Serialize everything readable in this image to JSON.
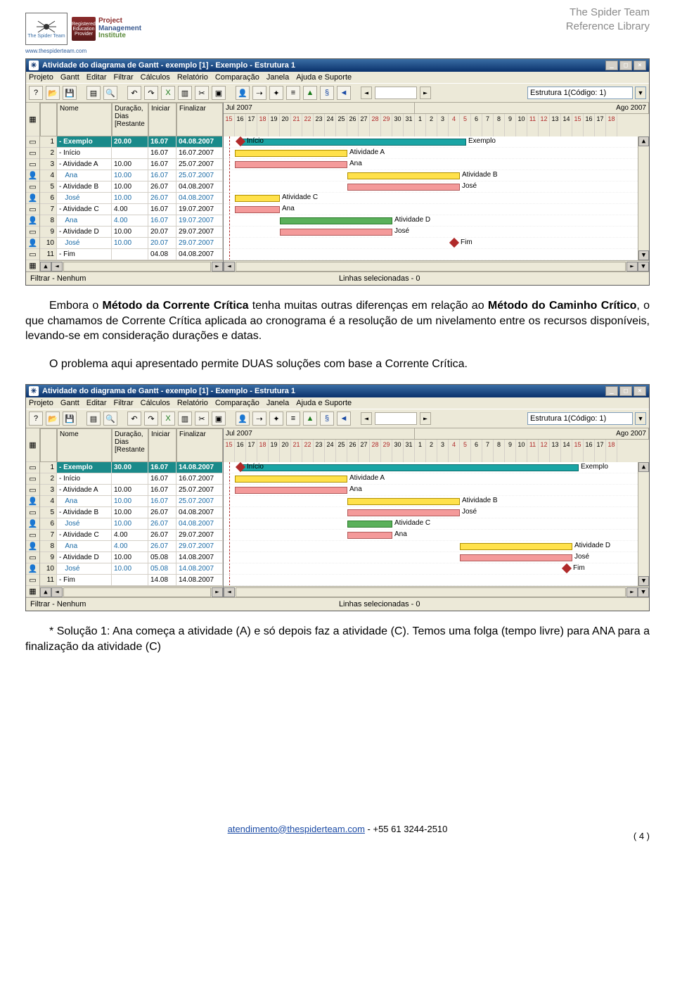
{
  "header": {
    "ref_line1": "The Spider Team",
    "ref_line2": "Reference Library",
    "spider_name": "The Spider Team",
    "url": "www.thespiderteam.com",
    "pmi1": "Project",
    "pmi2": "Management",
    "pmi3": "Institute",
    "pmi_badge": "Registered Education Provider"
  },
  "para1_a": "Embora o ",
  "para1_b": "Método da Corrente Crítica",
  "para1_c": " tenha muitas outras diferenças em relação ao ",
  "para1_d": "Método do Caminho Crítico",
  "para1_e": ", o que chamamos de Corrente Crítica aplicada ao cronograma é a resolução de um nivelamento entre os recursos disponíveis, levando-se em consideração durações e datas.",
  "para2": "O problema aqui apresentado permite DUAS soluções com base a Corrente Crítica.",
  "para3": "* Solução 1: Ana começa a atividade (A) e só depois faz a atividade (C). Temos uma folga (tempo livre) para ANA para a finalização da atividade (C)",
  "gantt_common": {
    "title": "Atividade do diagrama de Gantt - exemplo [1] - Exemplo - Estrutura 1",
    "menu": [
      "Projeto",
      "Gantt",
      "Editar",
      "Filtrar",
      "Cálculos",
      "Relatório",
      "Comparação",
      "Janela",
      "Ajuda e Suporte"
    ],
    "combo_value": "Estrutura 1(Código: 1)",
    "col_nome": "Nome",
    "col_dur": "Duração, Dias [Restante",
    "col_ini": "Iniciar",
    "col_fin": "Finalizar",
    "month1": "Jul 2007",
    "month2": "Ago 2007",
    "status_left": "Filtrar -  Nenhum",
    "status_mid": "Linhas selecionadas -  0"
  },
  "gantt1": {
    "dur_exemplo": "20.00",
    "rows": [
      {
        "n": "1",
        "nm": "Exemplo",
        "du": "20.00",
        "in": "16.07",
        "fi": "04.08.2007",
        "type": "acc"
      },
      {
        "n": "2",
        "nm": "Início",
        "du": "",
        "in": "16.07",
        "fi": "16.07.2007",
        "type": "task"
      },
      {
        "n": "3",
        "nm": "Atividade A",
        "du": "10.00",
        "in": "16.07",
        "fi": "25.07.2007",
        "type": "task"
      },
      {
        "n": "4",
        "nm": "Ana",
        "du": "10.00",
        "in": "16.07",
        "fi": "25.07.2007",
        "type": "res"
      },
      {
        "n": "5",
        "nm": "Atividade B",
        "du": "10.00",
        "in": "26.07",
        "fi": "04.08.2007",
        "type": "task"
      },
      {
        "n": "6",
        "nm": "José",
        "du": "10.00",
        "in": "26.07",
        "fi": "04.08.2007",
        "type": "res"
      },
      {
        "n": "7",
        "nm": "Atividade C",
        "du": "4.00",
        "in": "16.07",
        "fi": "19.07.2007",
        "type": "task"
      },
      {
        "n": "8",
        "nm": "Ana",
        "du": "4.00",
        "in": "16.07",
        "fi": "19.07.2007",
        "type": "res"
      },
      {
        "n": "9",
        "nm": "Atividade D",
        "du": "10.00",
        "in": "20.07",
        "fi": "29.07.2007",
        "type": "task"
      },
      {
        "n": "10",
        "nm": "José",
        "du": "10.00",
        "in": "20.07",
        "fi": "29.07.2007",
        "type": "res"
      },
      {
        "n": "11",
        "nm": "Fim",
        "du": "",
        "in": "04.08",
        "fi": "04.08.2007",
        "type": "task"
      }
    ],
    "days": [
      "15",
      "16",
      "17",
      "18",
      "19",
      "20",
      "21",
      "22",
      "23",
      "24",
      "25",
      "26",
      "27",
      "28",
      "29",
      "30",
      "31",
      "1",
      "2",
      "3",
      "4",
      "5",
      "6",
      "7",
      "8",
      "9",
      "10",
      "11",
      "12",
      "13",
      "14",
      "15",
      "16",
      "17",
      "18"
    ],
    "red_days": [
      "15",
      "21",
      "22",
      "28",
      "29",
      "4",
      "5",
      "11",
      "12",
      "18"
    ],
    "labels": {
      "ex": "Exemplo",
      "in": "Início",
      "a": "Atividade A",
      "ana": "Ana",
      "b": "Atividade B",
      "jo": "José",
      "c": "Atividade C",
      "d": "Atividade D",
      "fi": "Fim"
    }
  },
  "gantt2": {
    "dur_exemplo": "30.00",
    "rows": [
      {
        "n": "1",
        "nm": "Exemplo",
        "du": "30.00",
        "in": "16.07",
        "fi": "14.08.2007",
        "type": "acc"
      },
      {
        "n": "2",
        "nm": "Início",
        "du": "",
        "in": "16.07",
        "fi": "16.07.2007",
        "type": "task"
      },
      {
        "n": "3",
        "nm": "Atividade A",
        "du": "10.00",
        "in": "16.07",
        "fi": "25.07.2007",
        "type": "task"
      },
      {
        "n": "4",
        "nm": "Ana",
        "du": "10.00",
        "in": "16.07",
        "fi": "25.07.2007",
        "type": "res"
      },
      {
        "n": "5",
        "nm": "Atividade B",
        "du": "10.00",
        "in": "26.07",
        "fi": "04.08.2007",
        "type": "task"
      },
      {
        "n": "6",
        "nm": "José",
        "du": "10.00",
        "in": "26.07",
        "fi": "04.08.2007",
        "type": "res"
      },
      {
        "n": "7",
        "nm": "Atividade C",
        "du": "4.00",
        "in": "26.07",
        "fi": "29.07.2007",
        "type": "task"
      },
      {
        "n": "8",
        "nm": "Ana",
        "du": "4.00",
        "in": "26.07",
        "fi": "29.07.2007",
        "type": "res"
      },
      {
        "n": "9",
        "nm": "Atividade D",
        "du": "10.00",
        "in": "05.08",
        "fi": "14.08.2007",
        "type": "task"
      },
      {
        "n": "10",
        "nm": "José",
        "du": "10.00",
        "in": "05.08",
        "fi": "14.08.2007",
        "type": "res"
      },
      {
        "n": "11",
        "nm": "Fim",
        "du": "",
        "in": "14.08",
        "fi": "14.08.2007",
        "type": "task"
      }
    ],
    "days": [
      "15",
      "16",
      "17",
      "18",
      "19",
      "20",
      "21",
      "22",
      "23",
      "24",
      "25",
      "26",
      "27",
      "28",
      "29",
      "30",
      "31",
      "1",
      "2",
      "3",
      "4",
      "5",
      "6",
      "7",
      "8",
      "9",
      "10",
      "11",
      "12",
      "13",
      "14",
      "15",
      "16",
      "17",
      "18"
    ],
    "red_days": [
      "15",
      "21",
      "22",
      "28",
      "29",
      "4",
      "5",
      "11",
      "12",
      "18"
    ],
    "labels": {
      "ex": "Exemplo",
      "in": "Início",
      "a": "Atividade A",
      "ana": "Ana",
      "b": "Atividade B",
      "jo": "José",
      "c": "Atividade C",
      "d": "Atividade D",
      "fi": "Fim"
    }
  },
  "footer": {
    "email": "atendimento@thespiderteam.com",
    "phone": " - +55 61 3244-2510",
    "page": "( 4 )"
  },
  "chart_data": [
    {
      "type": "gantt",
      "title": "Exemplo - Estrutura 1 (baseline)",
      "x_unit": "days",
      "x_start": "2007-07-15",
      "tasks": [
        {
          "name": "Exemplo",
          "start": "2007-07-16",
          "end": "2007-08-04",
          "kind": "summary"
        },
        {
          "name": "Início",
          "start": "2007-07-16",
          "end": "2007-07-16",
          "kind": "milestone"
        },
        {
          "name": "Atividade A",
          "start": "2007-07-16",
          "end": "2007-07-25",
          "resource": "Ana"
        },
        {
          "name": "Atividade B",
          "start": "2007-07-26",
          "end": "2007-08-04",
          "resource": "José"
        },
        {
          "name": "Atividade C",
          "start": "2007-07-16",
          "end": "2007-07-19",
          "resource": "Ana"
        },
        {
          "name": "Atividade D",
          "start": "2007-07-20",
          "end": "2007-07-29",
          "resource": "José"
        },
        {
          "name": "Fim",
          "start": "2007-08-04",
          "end": "2007-08-04",
          "kind": "milestone"
        }
      ]
    },
    {
      "type": "gantt",
      "title": "Exemplo - Estrutura 1 (Solução 1)",
      "x_unit": "days",
      "x_start": "2007-07-15",
      "tasks": [
        {
          "name": "Exemplo",
          "start": "2007-07-16",
          "end": "2007-08-14",
          "kind": "summary"
        },
        {
          "name": "Início",
          "start": "2007-07-16",
          "end": "2007-07-16",
          "kind": "milestone"
        },
        {
          "name": "Atividade A",
          "start": "2007-07-16",
          "end": "2007-07-25",
          "resource": "Ana"
        },
        {
          "name": "Atividade B",
          "start": "2007-07-26",
          "end": "2007-08-04",
          "resource": "José"
        },
        {
          "name": "Atividade C",
          "start": "2007-07-26",
          "end": "2007-07-29",
          "resource": "Ana"
        },
        {
          "name": "Atividade D",
          "start": "2007-08-05",
          "end": "2007-08-14",
          "resource": "José"
        },
        {
          "name": "Fim",
          "start": "2007-08-14",
          "end": "2007-08-14",
          "kind": "milestone"
        }
      ]
    }
  ]
}
